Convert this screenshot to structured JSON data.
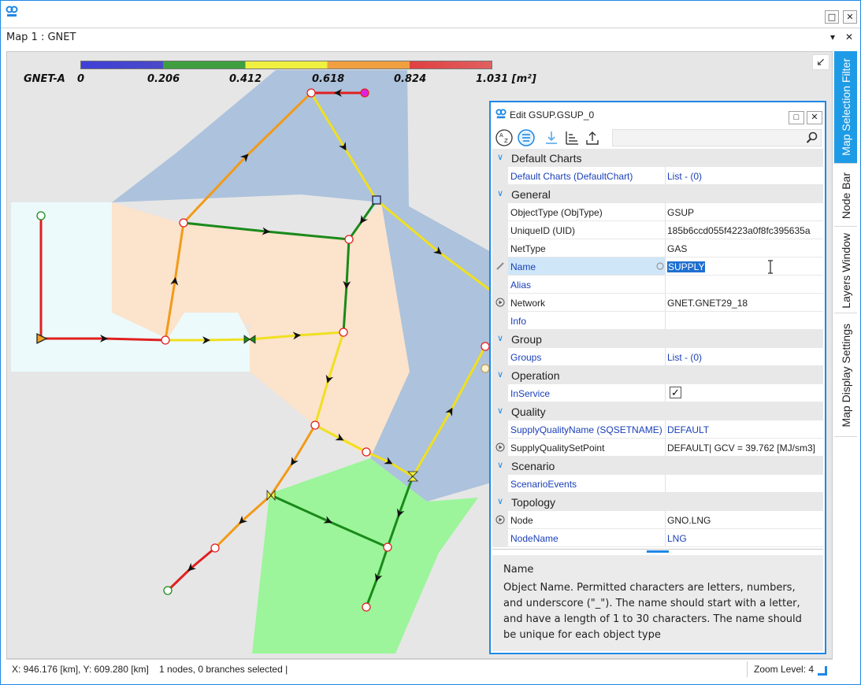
{
  "window": {
    "title_logo": "GNET",
    "restore_label": "□",
    "close_label": "✕"
  },
  "document": {
    "title": "Map 1 : GNET",
    "dropdown_label": "▾",
    "close_label": "✕"
  },
  "legend": {
    "name": "GNET-A",
    "ticks": [
      "0",
      "0.206",
      "0.412",
      "0.618",
      "0.824",
      "1.031 [m²]"
    ]
  },
  "map": {
    "collapse_label": "↙"
  },
  "side_tabs": [
    "Map Selection Filter",
    "Node Bar",
    "Layers Window",
    "Map Display Settings"
  ],
  "edit_panel": {
    "title": "Edit GSUP.GSUP_0",
    "restore_label": "□",
    "close_label": "✕",
    "search_placeholder": "",
    "categories": [
      {
        "label": "Default Charts",
        "props": [
          {
            "name": "Default Charts (DefaultChart)",
            "value": "List - (0)",
            "name_blue": true,
            "value_blue": true
          }
        ]
      },
      {
        "label": "General",
        "props": [
          {
            "name": "ObjectType (ObjType)",
            "value": "GSUP"
          },
          {
            "name": "UniqueID (UID)",
            "value": "185b6ccd055f4223a0f8fc395635a"
          },
          {
            "name": "NetType",
            "value": "GAS"
          },
          {
            "name": "Name",
            "value": "SUPPLY",
            "name_blue": true,
            "selected": true
          },
          {
            "name": "Alias",
            "value": "",
            "name_blue": true
          },
          {
            "name": "Network",
            "value": "GNET.GNET29_18",
            "icon": "circle-arrow-icon"
          },
          {
            "name": "Info",
            "value": "",
            "name_blue": true
          }
        ]
      },
      {
        "label": "Group",
        "props": [
          {
            "name": "Groups",
            "value": "List - (0)",
            "name_blue": true,
            "value_blue": true
          }
        ]
      },
      {
        "label": "Operation",
        "props": [
          {
            "name": "InService",
            "value": "✓",
            "name_blue": true,
            "checkbox": true
          }
        ]
      },
      {
        "label": "Quality",
        "props": [
          {
            "name": "SupplyQualityName (SQSETNAME)",
            "value": "DEFAULT",
            "name_blue": true,
            "value_blue": true
          },
          {
            "name": "SupplyQualitySetPoint",
            "value": "DEFAULT| GCV =  39.762 [MJ/sm3]",
            "icon": "circle-arrow-icon"
          }
        ]
      },
      {
        "label": "Scenario",
        "props": [
          {
            "name": "ScenarioEvents",
            "value": "",
            "name_blue": true
          }
        ]
      },
      {
        "label": "Topology",
        "props": [
          {
            "name": "Node",
            "value": "GNO.LNG",
            "icon": "circle-arrow-icon"
          },
          {
            "name": "NodeName",
            "value": "LNG",
            "name_blue": true,
            "value_blue": true
          }
        ]
      }
    ],
    "description": {
      "title": "Name",
      "body": "Object Name. Permitted characters are letters, numbers, and underscore (\"_\"). The name should start with a letter, and have a length of 1 to 30 characters. The name should be unique for each object type"
    }
  },
  "status": {
    "coords": "X: 946.176 [km], Y: 609.280 [km]",
    "selection": "1 nodes, 0 branches selected  |",
    "zoom": "Zoom Level: 4"
  }
}
